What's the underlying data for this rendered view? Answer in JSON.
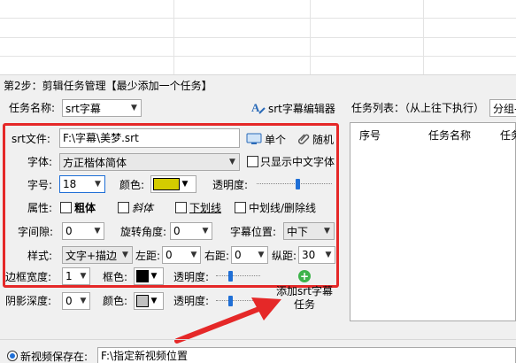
{
  "step2_title": "第2步：剪辑任务管理【最少添加一个任务】",
  "task_name": {
    "label": "任务名称:",
    "value": "srt字幕"
  },
  "srt_editor_button": "srt字幕编辑器",
  "task_list": {
    "label": "任务列表：（从上往下执行）",
    "group_value": "分组-",
    "columns": [
      "序号",
      "任务名称",
      "任务"
    ]
  },
  "srt_file": {
    "label": "srt文件:",
    "value": "F:\\字幕\\美梦.srt",
    "single_button": "单个",
    "random_button": "随机"
  },
  "font": {
    "label": "字体:",
    "value": "方正楷体简体",
    "only_chinese_label": "只显示中文字体"
  },
  "font_size": {
    "label": "字号:",
    "value": "18",
    "color_label": "颜色:",
    "color": "#d4cc00",
    "opacity_label": "透明度:",
    "opacity_level": 0.55
  },
  "attributes": {
    "label": "属性:",
    "bold": "粗体",
    "italic": "斜体",
    "underline": "下划线",
    "strike": "中划线/删除线"
  },
  "spacing": {
    "label": "字间隙:",
    "value": "0",
    "rotation_label": "旋转角度:",
    "rotation_value": "0",
    "position_label": "字幕位置:",
    "position_value": "中下"
  },
  "style": {
    "label": "样式:",
    "value": "文字+描边",
    "left_label": "左距:",
    "left_value": "0",
    "right_label": "右距:",
    "right_value": "0",
    "vertical_label": "纵距:",
    "vertical_value": "30"
  },
  "border": {
    "label": "边框宽度:",
    "value": "1",
    "color_label": "框色:",
    "color": "#000000",
    "opacity_label": "透明度:",
    "opacity_level": 0.3
  },
  "shadow": {
    "label": "阴影深度:",
    "value": "0",
    "color_label": "颜色:",
    "color": "#c0c0c0",
    "opacity_label": "透明度:",
    "opacity_level": 0.3
  },
  "add_task_button": {
    "line1": "添加srt字幕",
    "line2": "任务"
  },
  "save_to": {
    "label": "新视频保存在:",
    "value": "F:\\指定新视频位置"
  },
  "colors": {
    "red_annotation": "#e52828",
    "accent_blue": "#1f6fd6"
  }
}
